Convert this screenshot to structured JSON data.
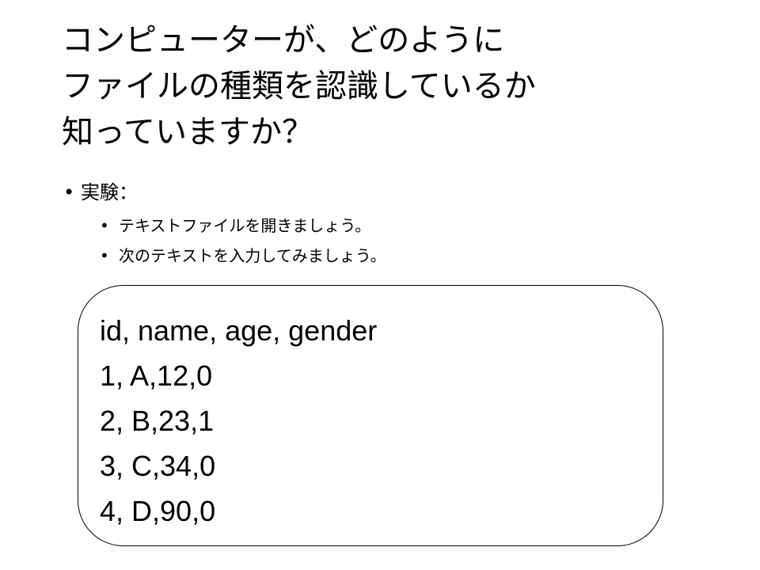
{
  "title": {
    "lines": [
      "コンピューターが、どのように",
      "ファイルの種類を認識しているか",
      "知っていますか？"
    ]
  },
  "bullets": {
    "marker": "•",
    "experiment": {
      "label": "実験：",
      "items": [
        "テキストファイルを開きましょう。",
        "次のテキストを入力してみましょう。"
      ]
    }
  },
  "code_box": {
    "lines": [
      "id, name, age, gender",
      "1, A,12,0",
      "2, B,23,1",
      "3, C,34,0",
      "4, D,90,0"
    ]
  }
}
